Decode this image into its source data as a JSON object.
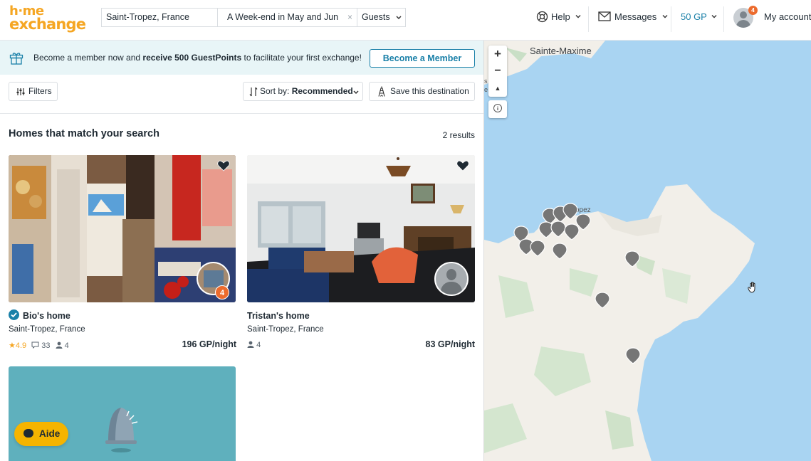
{
  "header": {
    "logo_top": "h·me",
    "logo_bottom": "exchange",
    "destination": "Saint-Tropez, France",
    "dates": "A Week-end in May and Jun",
    "clear": "×",
    "guests": "Guests",
    "help": "Help",
    "messages": "Messages",
    "gp": "50 GP",
    "account": "My account",
    "notification_count": "4"
  },
  "banner": {
    "text_before": "Become a member now and ",
    "text_bold": "receive 500 GuestPoints",
    "text_after": " to facilitate your first exchange!",
    "button": "Become a Member"
  },
  "toolbar": {
    "filters": "Filters",
    "sort_prefix": "Sort by:",
    "sort_value": "Recommended",
    "save": "Save this destination"
  },
  "results": {
    "title": "Homes that match your search",
    "count": "2 results"
  },
  "cards": [
    {
      "title": "Bio's home",
      "location": "Saint-Tropez, France",
      "rating": "4.9",
      "reviews": "33",
      "guests": "4",
      "price": "196 GP/night",
      "host_badge": "4"
    },
    {
      "title": "Tristan's home",
      "location": "Saint-Tropez, France",
      "guests": "4",
      "price": "83 GP/night"
    }
  ],
  "chat": {
    "label": "Aide"
  },
  "map": {
    "place_1": "Sainte-Maxime",
    "place_2": "opez",
    "place_3": "s",
    "place_4": "e",
    "zoom_in": "+",
    "zoom_out": "−",
    "reset": "▲",
    "info": "i"
  }
}
